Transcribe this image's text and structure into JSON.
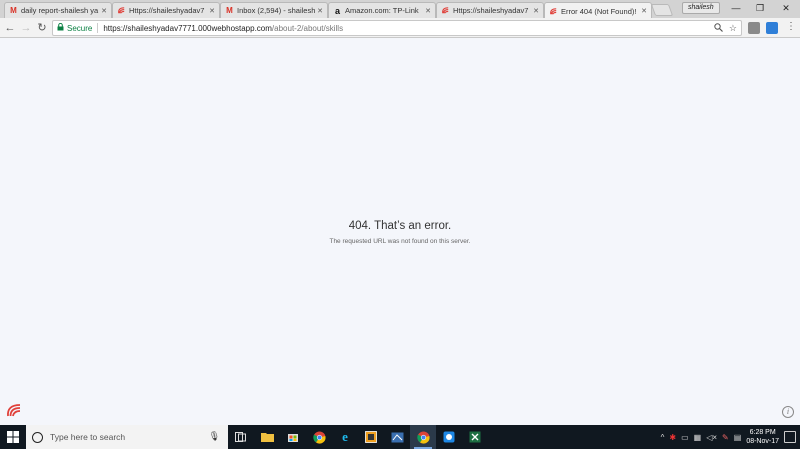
{
  "tabs": [
    {
      "title": "daily report-shailesh ya",
      "icon": "gmail-icon"
    },
    {
      "title": "Https://shaileshyadav7",
      "icon": "webhost-icon"
    },
    {
      "title": "Inbox (2,594) - shailesh",
      "icon": "gmail-icon"
    },
    {
      "title": "Amazon.com: TP-Link",
      "icon": "amazon-icon"
    },
    {
      "title": "Https://shaileshyadav7",
      "icon": "webhost-icon"
    },
    {
      "title": "Error 404 (Not Found)!",
      "icon": "webhost-icon",
      "active": true
    }
  ],
  "profile": {
    "name": "shailesh"
  },
  "address_bar": {
    "secure_label": "Secure",
    "host": "https://shaileshyadav7771.000webhostapp.com",
    "path": "/about-2/about/skills"
  },
  "page": {
    "error_title": "404. That’s an error.",
    "error_message": "The requested URL was not found on this server."
  },
  "taskbar": {
    "search_placeholder": "Type here to search",
    "time": "6:28 PM",
    "date": "08-Nov-17"
  },
  "colors": {
    "secure_green": "#0b8043",
    "page_bg": "#f4f6fb",
    "taskbar_bg": "#101820",
    "webhost_red": "#e0403a"
  }
}
